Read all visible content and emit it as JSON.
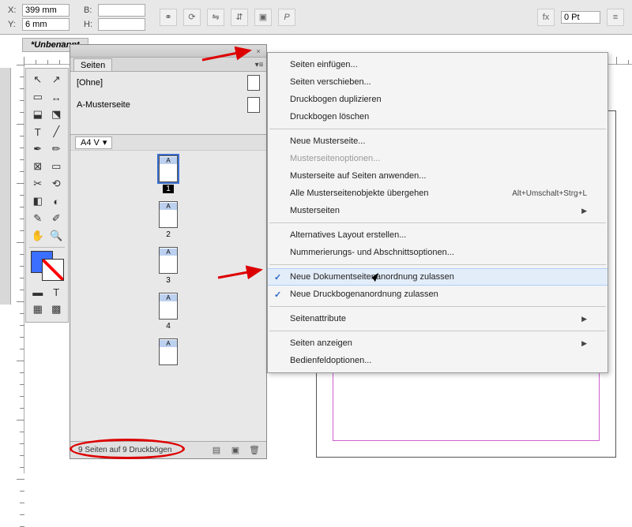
{
  "controlbar": {
    "x_label": "X:",
    "x_val": "399 mm",
    "y_label": "Y:",
    "y_val": "6 mm",
    "w_label": "B:",
    "w_val": "",
    "h_label": "H:",
    "h_val": "",
    "stroke_label": "0 Pt"
  },
  "doctab": {
    "title": "*Unbenannt"
  },
  "toolbox": {
    "tools": [
      "⬚",
      "↖",
      "⬚",
      "↗",
      "T",
      "／",
      "✒",
      "✏",
      "✂",
      "⟲",
      "⚗",
      "⬓",
      "◧",
      "✿",
      "◐",
      "☾",
      "▭",
      "T"
    ]
  },
  "pages_panel": {
    "tab": "Seiten",
    "masters": [
      {
        "label": "[Ohne]"
      },
      {
        "label": "A-Musterseite"
      }
    ],
    "layout": "A4 V",
    "pages": [
      {
        "letter": "A",
        "num": "1",
        "selected": true
      },
      {
        "letter": "A",
        "num": "2"
      },
      {
        "letter": "A",
        "num": "3"
      },
      {
        "letter": "A",
        "num": "4"
      },
      {
        "letter": "A",
        "num": ""
      }
    ],
    "status": "9 Seiten auf 9 Druckbögen"
  },
  "menu": {
    "items": [
      {
        "label": "Seiten einfügen..."
      },
      {
        "label": "Seiten verschieben..."
      },
      {
        "label": "Druckbogen duplizieren"
      },
      {
        "label": "Druckbogen löschen"
      },
      {
        "sep": true
      },
      {
        "label": "Neue Musterseite..."
      },
      {
        "label": "Musterseitenoptionen...",
        "disabled": true
      },
      {
        "label": "Musterseite auf Seiten anwenden..."
      },
      {
        "label": "Alle Musterseitenobjekte übergehen",
        "accel": "Alt+Umschalt+Strg+L"
      },
      {
        "label": "Musterseiten",
        "submenu": true
      },
      {
        "sep": true
      },
      {
        "label": "Alternatives Layout erstellen..."
      },
      {
        "label": "Nummerierungs- und Abschnittsoptionen..."
      },
      {
        "sep": true
      },
      {
        "label": "Neue Dokumentseitenanordnung zulassen",
        "checked": true,
        "hover": true
      },
      {
        "label": "Neue Druckbogenanordnung zulassen",
        "checked": true
      },
      {
        "sep": true
      },
      {
        "label": "Seitenattribute",
        "submenu": true
      },
      {
        "sep": true
      },
      {
        "label": "Seiten anzeigen",
        "submenu": true
      },
      {
        "label": "Bedienfeldoptionen..."
      }
    ]
  }
}
